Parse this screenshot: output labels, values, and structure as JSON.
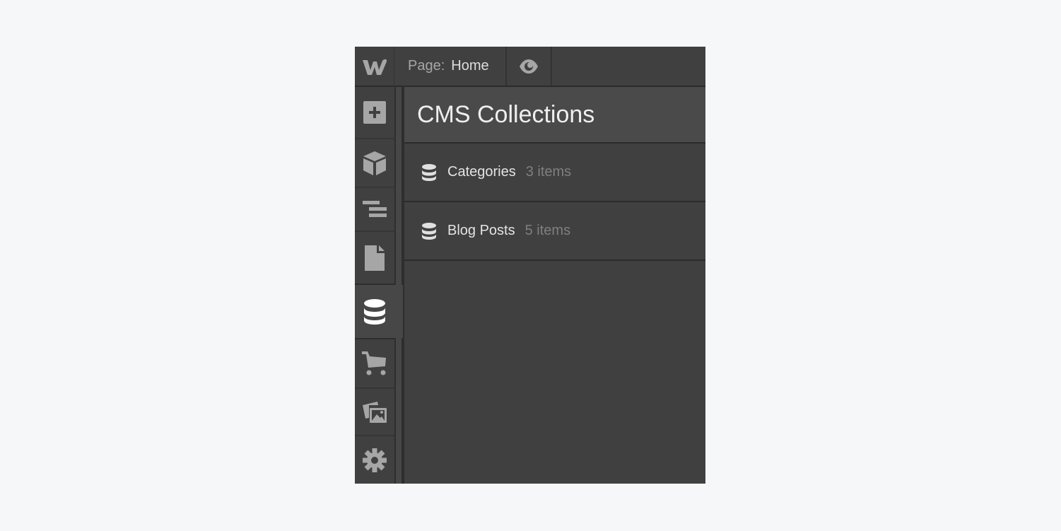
{
  "topbar": {
    "logo_icon": "webflow-logo-icon",
    "page_label": "Page:",
    "page_value": "Home",
    "preview_icon": "eye-icon"
  },
  "leftbar": {
    "items": [
      {
        "name": "add-elements",
        "icon": "plus-square-icon",
        "active": false
      },
      {
        "name": "symbols",
        "icon": "cube-icon",
        "active": false
      },
      {
        "name": "navigator",
        "icon": "navigator-lines-icon",
        "active": false
      },
      {
        "name": "pages",
        "icon": "page-icon",
        "active": false
      },
      {
        "name": "cms",
        "icon": "database-icon",
        "active": true
      },
      {
        "name": "ecommerce",
        "icon": "cart-icon",
        "active": false
      },
      {
        "name": "assets",
        "icon": "images-icon",
        "active": false
      },
      {
        "name": "settings",
        "icon": "gear-icon",
        "active": false
      }
    ]
  },
  "panel": {
    "title": "CMS Collections",
    "collections": [
      {
        "name": "Categories",
        "count": "3 items"
      },
      {
        "name": "Blog Posts",
        "count": "5 items"
      }
    ]
  },
  "colors": {
    "background": "#f6f7f8",
    "panel": "#404040",
    "header": "#4a4a4a",
    "icon": "#a6a6a6",
    "icon_active": "#ffffff"
  }
}
